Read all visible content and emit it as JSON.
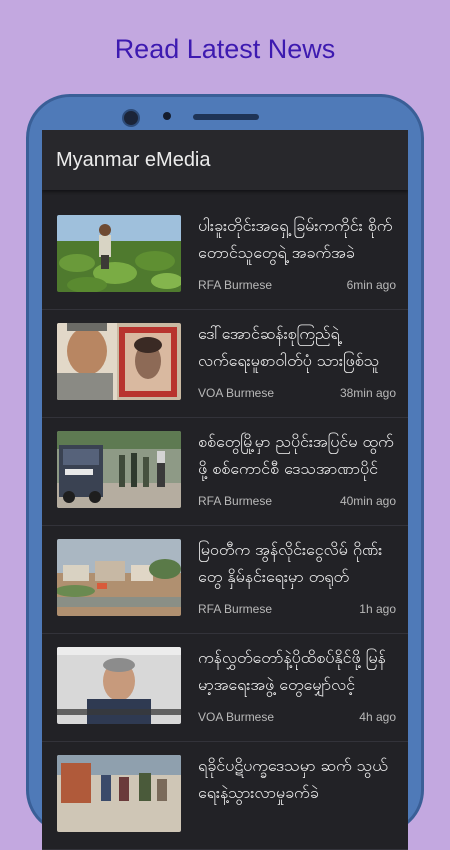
{
  "headline": "Read Latest News",
  "app": {
    "title": "Myanmar eMedia"
  },
  "articles": [
    {
      "title": "ပါးခူးတိုင်းအရှေ့ ခြမ်းကကိုင်း စိုက်တောင်သူတွေရဲ့ အခက်အခဲ",
      "source": "RFA Burmese",
      "time": "6min ago",
      "thumb": "taro-field-farmer"
    },
    {
      "title": "ဒေါ်အောင်ဆန်းစုကြည်ရဲ့ လက်ရေးမူစာဝါတ်ပုံ သားဖြစ်သူ",
      "source": "VOA Burmese",
      "time": "38min ago",
      "thumb": "man-with-portrait"
    },
    {
      "title": "စစ်တွေမြို့မှာ ညပိုင်းအပြင်မ ထွက်ဖို့ စစ်ကောင်စီ ဒေသအာဏာပိုင်",
      "source": "RFA Burmese",
      "time": "40min ago",
      "thumb": "police-truck"
    },
    {
      "title": "မြဝတီက အွန်လိုင်းငွေလိမ် ဂိုဏ်းတွေ နှိမ်နင်းရေးမှာ တရုတ်",
      "source": "RFA Burmese",
      "time": "1h ago",
      "thumb": "riverbank-buildings"
    },
    {
      "title": "ကန်လွှတ်တော်နဲ့ပိုထိစပ်နိုင်ဖို့ မြန်မာ့အရေးအဖွဲ့ တွေမျှော်လင့်",
      "source": "VOA Burmese",
      "time": "4h ago",
      "thumb": "video-interview"
    },
    {
      "title": "ရခိုင်ပဋိပက္ခဒေသမှာ ဆက် သွယ်ရေးနဲ့သွားလာမှုခက်ခဲ",
      "source": "",
      "time": "",
      "thumb": "camp-crowd"
    }
  ],
  "colors": {
    "background": "#c3a8e0",
    "headline": "#3d1ab0",
    "phone": "#4f7ab8",
    "screen": "#222226"
  }
}
